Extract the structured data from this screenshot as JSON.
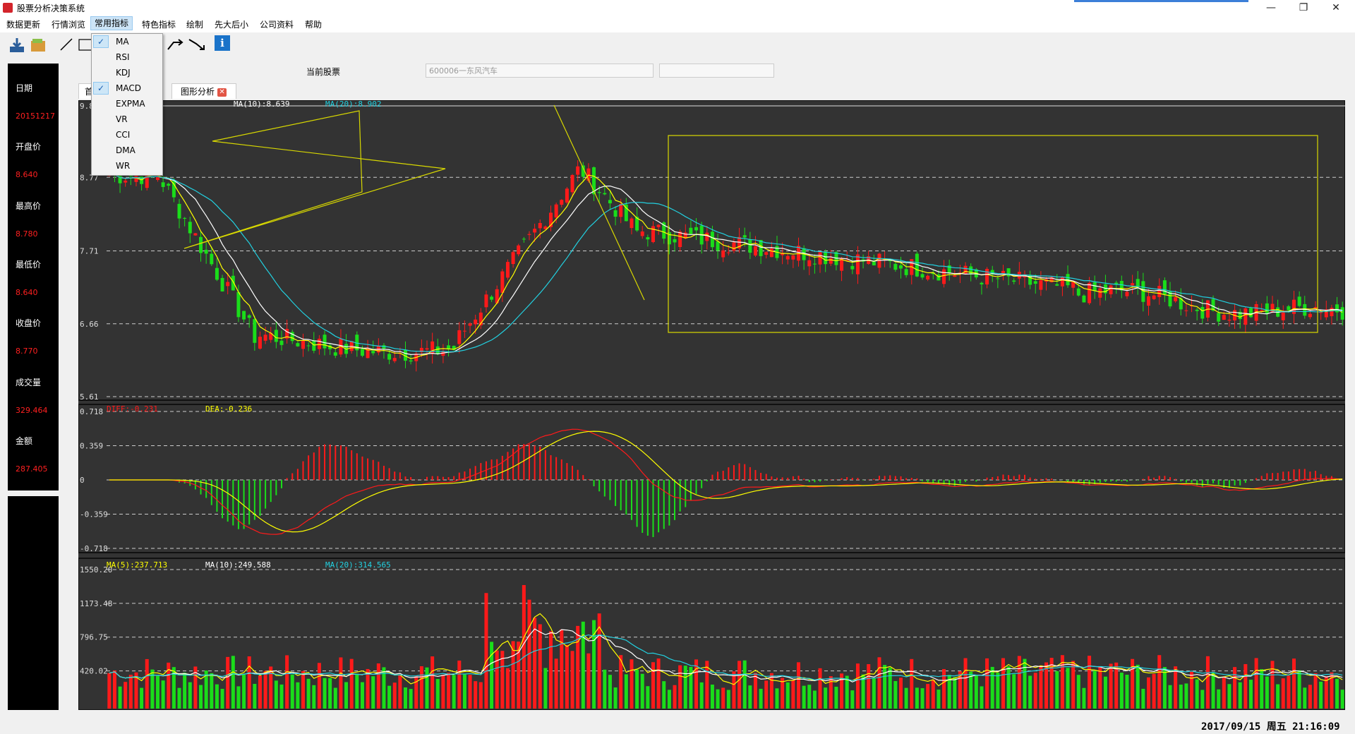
{
  "app": {
    "title": "股票分析决策系统"
  },
  "window_controls": {
    "minimize": "—",
    "maximize": "❐",
    "close": "✕"
  },
  "menu": [
    "数据更新",
    "行情浏览",
    "常用指标",
    "特色指标",
    "绘制",
    "先大后小",
    "公司资料",
    "帮助"
  ],
  "dropdown": {
    "items": [
      {
        "label": "MA",
        "checked": true
      },
      {
        "label": "RSI",
        "checked": false
      },
      {
        "label": "KDJ",
        "checked": false
      },
      {
        "label": "MACD",
        "checked": true
      },
      {
        "label": "EXPMA",
        "checked": false
      },
      {
        "label": "VR",
        "checked": false
      },
      {
        "label": "CCI",
        "checked": false
      },
      {
        "label": "DMA",
        "checked": false
      },
      {
        "label": "WR",
        "checked": false
      }
    ],
    "check_glyph": "✓"
  },
  "toolbar": {
    "info_glyph": "i"
  },
  "left_panel": [
    {
      "label": "日期",
      "value": "20151217"
    },
    {
      "label": "开盘价",
      "value": "8.640"
    },
    {
      "label": "最高价",
      "value": "8.780"
    },
    {
      "label": "最低价",
      "value": "8.640"
    },
    {
      "label": "收盘价",
      "value": "8.770"
    },
    {
      "label": "成交量",
      "value": "329.464"
    },
    {
      "label": "金额",
      "value": "287.405"
    }
  ],
  "stock": {
    "label": "当前股票",
    "value": "600006一东风汽车"
  },
  "tabs": [
    {
      "label": "首"
    },
    {
      "label": "图形分析",
      "close_glyph": "✕"
    }
  ],
  "colors": {
    "up": "#ff1a1a",
    "down": "#1add1a",
    "ma5": "#ffff00",
    "ma10": "#ffffff",
    "ma20": "#22d0e0",
    "drawing": "#d8d800"
  },
  "chart_data": [
    {
      "type": "candlestick",
      "panel": "price",
      "legend": [
        {
          "name": "MA(10)",
          "text": "MA(10):8.639"
        },
        {
          "name": "MA(20)",
          "text": "MA(20):8.902"
        }
      ],
      "yticks": [
        "9.8",
        "8.77",
        "7.71",
        "6.66",
        "5.61"
      ],
      "ylim": [
        5.61,
        9.8
      ]
    },
    {
      "type": "bar",
      "panel": "macd",
      "legend": [
        {
          "name": "DIFF",
          "text": "DIFF:-0.231"
        },
        {
          "name": "DEA",
          "text": "DEA:-0.236"
        }
      ],
      "yticks": [
        "0.718",
        "0.359",
        "0",
        "-0.359",
        "-0.718"
      ],
      "ylim": [
        -0.718,
        0.718
      ]
    },
    {
      "type": "bar",
      "panel": "volume",
      "legend": [
        {
          "name": "MA(5)",
          "text": "MA(5):237.713"
        },
        {
          "name": "MA(10)",
          "text": "MA(10):249.588"
        },
        {
          "name": "MA(20)",
          "text": "MA(20):314.565"
        }
      ],
      "yticks": [
        "1550.20",
        "1173.48",
        "796.75",
        "420.02"
      ],
      "ylim": [
        0,
        1550.2
      ]
    }
  ],
  "status": {
    "datetime": "2017/09/15 周五 21:16:09"
  }
}
